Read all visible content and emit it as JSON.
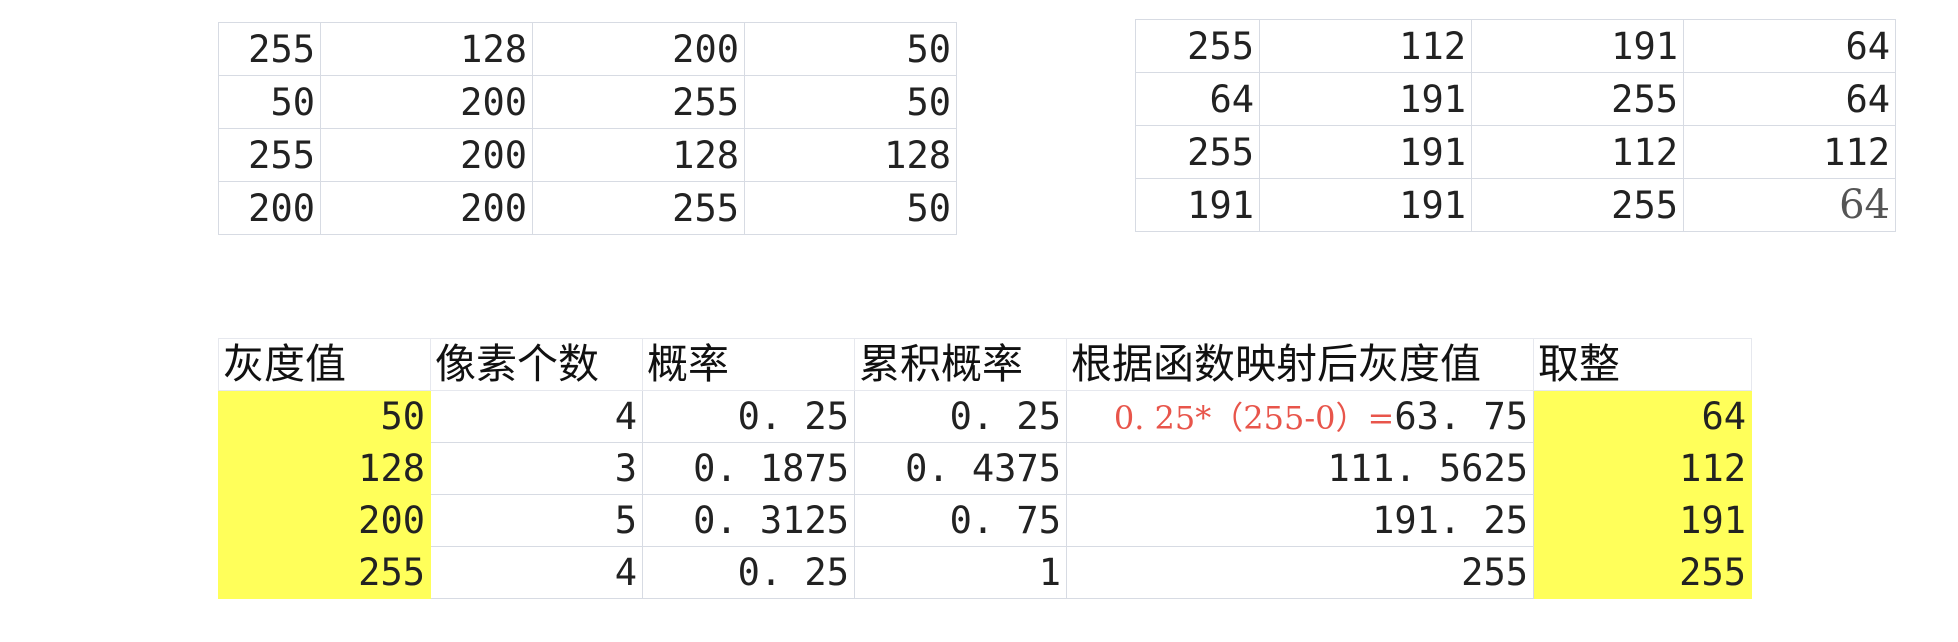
{
  "top_left_grid": {
    "rows": [
      [
        "255",
        "128",
        "200",
        "50"
      ],
      [
        "50",
        "200",
        "255",
        "50"
      ],
      [
        "255",
        "200",
        "128",
        "128"
      ],
      [
        "200",
        "200",
        "255",
        "50"
      ]
    ]
  },
  "top_right_grid": {
    "rows": [
      [
        "255",
        "112",
        "191",
        "64"
      ],
      [
        "64",
        "191",
        "255",
        "64"
      ],
      [
        "255",
        "191",
        "112",
        "112"
      ],
      [
        "191",
        "191",
        "255",
        "64"
      ]
    ]
  },
  "calc_table": {
    "headers": [
      "灰度值",
      "像素个数",
      "概率",
      "累积概率",
      "根据函数映射后灰度值",
      "取整"
    ],
    "rows": [
      {
        "gray": "50",
        "count": "4",
        "prob": "0. 25",
        "cum": "0. 25",
        "mapped_red": "0. 25*（255-0）=",
        "mapped": "63. 75",
        "rounded": "64"
      },
      {
        "gray": "128",
        "count": "3",
        "prob": "0. 1875",
        "cum": "0. 4375",
        "mapped_red": "",
        "mapped": "111. 5625",
        "rounded": "112"
      },
      {
        "gray": "200",
        "count": "5",
        "prob": "0. 3125",
        "cum": "0. 75",
        "mapped_red": "",
        "mapped": "191. 25",
        "rounded": "191"
      },
      {
        "gray": "255",
        "count": "4",
        "prob": "0. 25",
        "cum": "1",
        "mapped_red": "",
        "mapped": "255",
        "rounded": "255"
      }
    ]
  },
  "colors": {
    "highlight": "#ffff5a",
    "formula_red": "#e8554b",
    "grid_line": "#d7dbe3"
  }
}
